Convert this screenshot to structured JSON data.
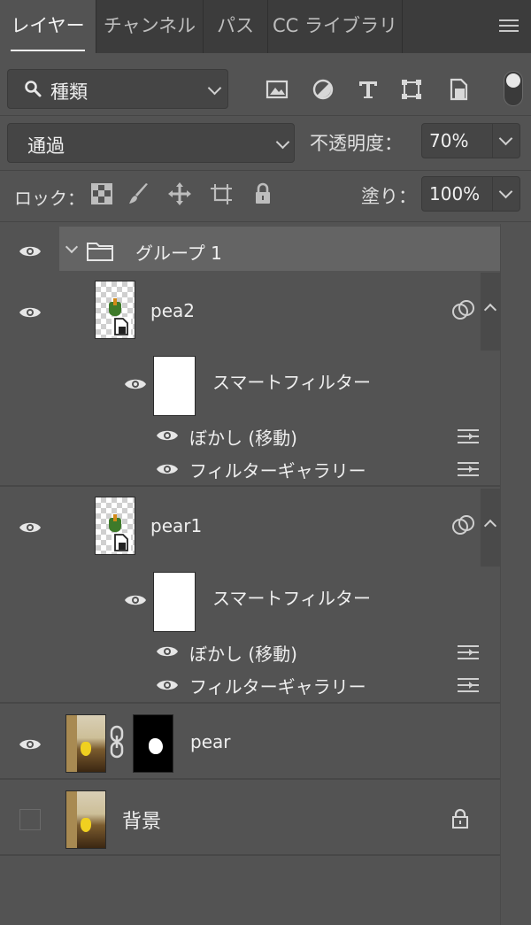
{
  "tabs": [
    {
      "label": "レイヤー",
      "active": true
    },
    {
      "label": "チャンネル",
      "active": false
    },
    {
      "label": "パス",
      "active": false
    },
    {
      "label": "CC ライブラリ",
      "active": false
    }
  ],
  "filter": {
    "kind_label": "種類"
  },
  "blend": {
    "mode": "通過",
    "opacity_label": "不透明度：",
    "opacity_value": "70%"
  },
  "lock": {
    "label": "ロック：",
    "fill_label": "塗り：",
    "fill_value": "100%"
  },
  "layers": {
    "group": {
      "name": "グループ 1"
    },
    "pea2": {
      "name": "pea2",
      "smart_filter_label": "スマートフィルター",
      "filters": [
        "ぼかし (移動)",
        "フィルターギャラリー"
      ]
    },
    "pear1": {
      "name": "pear1",
      "smart_filter_label": "スマートフィルター",
      "filters": [
        "ぼかし (移動)",
        "フィルターギャラリー"
      ]
    },
    "pear": {
      "name": "pear"
    },
    "background": {
      "name": "背景"
    }
  },
  "colors": {
    "panel": "#535353",
    "tabbar": "#3c3c3c",
    "field": "#454545",
    "group_row": "#646464"
  }
}
